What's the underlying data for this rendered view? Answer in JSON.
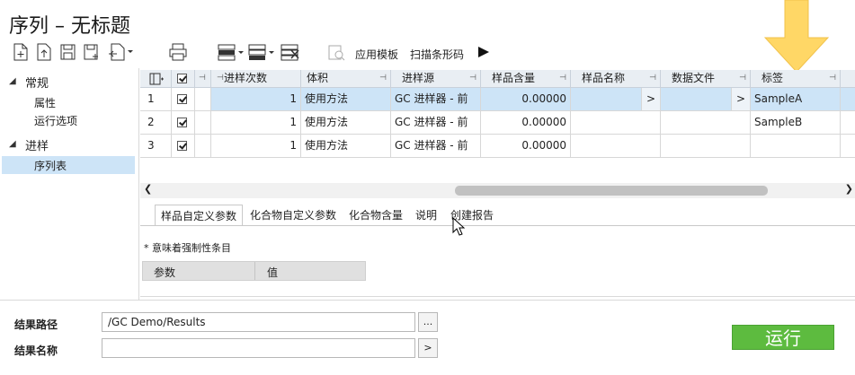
{
  "window": {
    "title": "序列 – 无标题"
  },
  "toolbar": {
    "apply_template": "应用模板",
    "scan_barcode": "扫描条形码"
  },
  "tree": {
    "groups": [
      {
        "label": "常规",
        "children": [
          "属性",
          "运行选项"
        ]
      },
      {
        "label": "进样",
        "children": [
          "序列表"
        ]
      }
    ],
    "selected": "序列表"
  },
  "grid": {
    "headers": [
      "进样次数",
      "体积",
      "进样源",
      "样品含量",
      "样品名称",
      "数据文件",
      "标签"
    ],
    "rows": [
      {
        "index": "1",
        "checked": true,
        "injections": "1",
        "volume": "使用方法",
        "source": "GC 进样器 - 前",
        "amount": "0.00000",
        "sample_name": "",
        "name_btn": ">",
        "data_file": "",
        "file_btn": ">",
        "label": "SampleA"
      },
      {
        "index": "2",
        "checked": true,
        "injections": "1",
        "volume": "使用方法",
        "source": "GC 进样器 - 前",
        "amount": "0.00000",
        "sample_name": "",
        "data_file": "",
        "label": "SampleB"
      },
      {
        "index": "3",
        "checked": true,
        "injections": "1",
        "volume": "使用方法",
        "source": "GC 进样器 - 前",
        "amount": "0.00000",
        "sample_name": "",
        "data_file": "",
        "label": ""
      }
    ]
  },
  "tabs": [
    "样品自定义参数",
    "化合物自定义参数",
    "化合物含量",
    "说明",
    "创建报告"
  ],
  "tab_active": "样品自定义参数",
  "params": {
    "note": "* 意味着强制性条目",
    "col_param": "参数",
    "col_value": "值"
  },
  "bottom": {
    "result_path_label": "结果路径",
    "result_path_value": "/GC Demo/Results",
    "result_path_btn": "...",
    "result_name_label": "结果名称",
    "result_name_value": "",
    "result_name_btn": ">",
    "run_label": "运行"
  },
  "colors": {
    "accent_arrow": "#ffd766",
    "run_button": "#5dbb3f",
    "selected_row": "#cde4f7"
  }
}
